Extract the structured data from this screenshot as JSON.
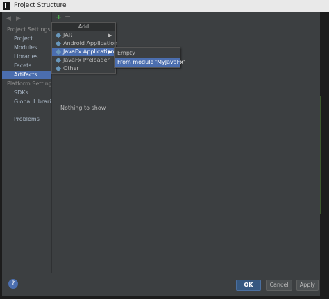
{
  "window": {
    "title": "Project Structure"
  },
  "sidebar": {
    "project_settings_header": "Project Settings",
    "project_items": [
      "Project",
      "Modules",
      "Libraries",
      "Facets",
      "Artifacts"
    ],
    "platform_settings_header": "Platform Settings",
    "platform_items": [
      "SDKs",
      "Global Libraries"
    ],
    "problems": "Problems",
    "selected": "Artifacts"
  },
  "toolbar": {
    "add_icon": "plus-icon",
    "remove_icon": "minus-icon"
  },
  "middle": {
    "empty_text": "Nothing to show"
  },
  "add_menu": {
    "title": "Add",
    "items": [
      {
        "label": "JAR",
        "icon": "artifact-icon",
        "has_submenu": true
      },
      {
        "label": "Android Application",
        "icon": "artifact-icon",
        "has_submenu": false
      },
      {
        "label": "JavaFx Application",
        "icon": "artifact-icon",
        "has_submenu": true,
        "highlighted": true
      },
      {
        "label": "JavaFx Preloader",
        "icon": "artifact-icon",
        "has_submenu": false
      },
      {
        "label": "Other",
        "icon": "artifact-icon",
        "has_submenu": false
      }
    ]
  },
  "submenu": {
    "items": [
      {
        "label": "Empty"
      },
      {
        "label": "From module 'MyJavaFx'",
        "highlighted": true
      }
    ]
  },
  "buttons": {
    "ok": "OK",
    "cancel": "Cancel",
    "apply": "Apply",
    "help": "?"
  },
  "colors": {
    "selection": "#4b6eaf",
    "background": "#3c3f41",
    "add_green": "#4aa84a"
  }
}
